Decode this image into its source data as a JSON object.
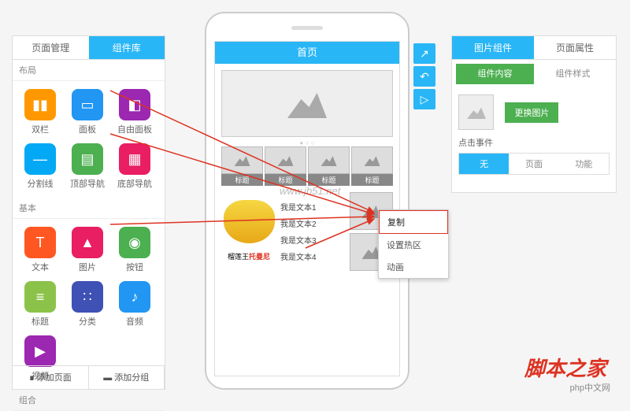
{
  "left_panel": {
    "tabs": [
      "页面管理",
      "组件库"
    ],
    "sections": {
      "layout": {
        "title": "布局",
        "items": [
          {
            "name": "双栏",
            "color": "#ff9800",
            "icon": "▮▮"
          },
          {
            "name": "面板",
            "color": "#2196f3",
            "icon": "▭"
          },
          {
            "name": "自由面板",
            "color": "#9c27b0",
            "icon": "◧"
          },
          {
            "name": "分割线",
            "color": "#03a9f4",
            "icon": "—"
          },
          {
            "name": "顶部导航",
            "color": "#4caf50",
            "icon": "▤"
          },
          {
            "name": "底部导航",
            "color": "#e91e63",
            "icon": "▦"
          }
        ]
      },
      "basic": {
        "title": "基本",
        "items": [
          {
            "name": "文本",
            "color": "#ff5722",
            "icon": "T"
          },
          {
            "name": "图片",
            "color": "#e91e63",
            "icon": "▲"
          },
          {
            "name": "按钮",
            "color": "#4caf50",
            "icon": "◉"
          },
          {
            "name": "标题",
            "color": "#8bc34a",
            "icon": "≡"
          },
          {
            "name": "分类",
            "color": "#3f51b5",
            "icon": "∷"
          },
          {
            "name": "音频",
            "color": "#2196f3",
            "icon": "♪"
          },
          {
            "name": "视频",
            "color": "#9c27b0",
            "icon": "▶"
          }
        ]
      },
      "combo": {
        "title": "组合"
      }
    },
    "bottom": [
      "添加页面",
      "添加分组"
    ]
  },
  "phone": {
    "header": "首页",
    "thumb_title": "标题",
    "texts": [
      "我是文本1",
      "我是文本2",
      "我是文本3",
      "我是文本4"
    ],
    "fruit_label_pre": "榴莲王",
    "fruit_label_b": "托曼尼"
  },
  "context_menu": [
    "复制",
    "设置热区",
    "动画"
  ],
  "right_panel": {
    "tabs": [
      "图片组件",
      "页面属性"
    ],
    "sub_tabs": [
      "组件内容",
      "组件样式"
    ],
    "change_img": "更换图片",
    "click_event": "点击事件",
    "event_opts": [
      "无",
      "页面",
      "功能"
    ]
  },
  "watermark": "www.jb51.net",
  "footer_logo": "脚本之家",
  "footer_sub": "php中文网"
}
